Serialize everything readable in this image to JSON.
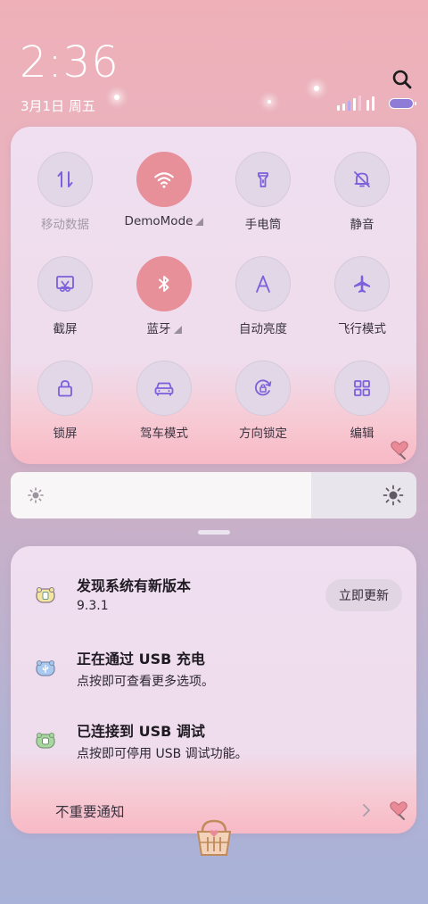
{
  "status": {
    "time": "2:36",
    "date": "3月1日 周五"
  },
  "colors": {
    "accent_active": "#e8909a",
    "icon_purple": "#7b5fdc",
    "battery": "#8e7cd6"
  },
  "quick_settings": {
    "tiles": [
      {
        "label": "移动数据",
        "icon": "mobile-data-icon",
        "active": false,
        "dim": true
      },
      {
        "label": "DemoMode",
        "icon": "wifi-icon",
        "active": true,
        "expandable": true
      },
      {
        "label": "手电筒",
        "icon": "flashlight-icon",
        "active": false
      },
      {
        "label": "静音",
        "icon": "mute-bell-icon",
        "active": false
      },
      {
        "label": "截屏",
        "icon": "screenshot-icon",
        "active": false
      },
      {
        "label": "蓝牙",
        "icon": "bluetooth-icon",
        "active": true,
        "expandable": true
      },
      {
        "label": "自动亮度",
        "icon": "auto-brightness-icon",
        "active": false
      },
      {
        "label": "飞行模式",
        "icon": "airplane-icon",
        "active": false
      },
      {
        "label": "锁屏",
        "icon": "lock-icon",
        "active": false
      },
      {
        "label": "驾车模式",
        "icon": "car-icon",
        "active": false
      },
      {
        "label": "方向锁定",
        "icon": "rotation-lock-icon",
        "active": false
      },
      {
        "label": "编辑",
        "icon": "grid-edit-icon",
        "active": false
      }
    ]
  },
  "brightness": {
    "level": 0.74
  },
  "notifications": [
    {
      "title": "发现系统有新版本",
      "body": "9.3.1",
      "icon": "update-app-icon",
      "action": "立即更新"
    },
    {
      "title": "正在通过 USB 充电",
      "body": "点按即可查看更多选项。",
      "icon": "usb-charge-icon"
    },
    {
      "title": "已连接到 USB 调试",
      "body": "点按即可停用 USB 调试功能。",
      "icon": "usb-debug-icon"
    }
  ],
  "unimportant_label": "不重要通知"
}
